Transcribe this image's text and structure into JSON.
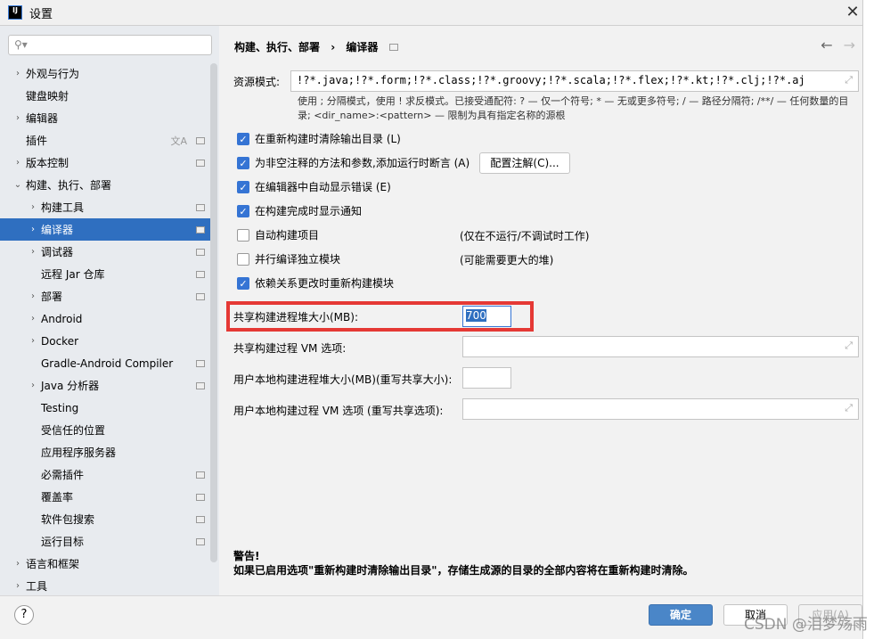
{
  "window": {
    "title": "设置",
    "logo": "IJ",
    "close": "✕"
  },
  "sidebar": {
    "search_placeholder": "",
    "items": [
      {
        "label": "外观与行为",
        "level": 0,
        "chevron": "›"
      },
      {
        "label": "键盘映射",
        "level": 0
      },
      {
        "label": "编辑器",
        "level": 0,
        "chevron": "›"
      },
      {
        "label": "插件",
        "level": 0,
        "translate": true,
        "icon": true
      },
      {
        "label": "版本控制",
        "level": 0,
        "chevron": "›",
        "icon": true
      },
      {
        "label": "构建、执行、部署",
        "level": 0,
        "chevron": "⌄"
      },
      {
        "label": "构建工具",
        "level": 1,
        "chevron": "›",
        "icon": true
      },
      {
        "label": "编译器",
        "level": 1,
        "chevron": "›",
        "icon": true,
        "selected": true
      },
      {
        "label": "调试器",
        "level": 1,
        "chevron": "›",
        "icon": true
      },
      {
        "label": "远程 Jar 仓库",
        "level": 1,
        "icon": true
      },
      {
        "label": "部署",
        "level": 1,
        "chevron": "›",
        "icon": true
      },
      {
        "label": "Android",
        "level": 1,
        "chevron": "›"
      },
      {
        "label": "Docker",
        "level": 1,
        "chevron": "›"
      },
      {
        "label": "Gradle-Android Compiler",
        "level": 1,
        "icon": true
      },
      {
        "label": "Java 分析器",
        "level": 1,
        "chevron": "›",
        "icon": true
      },
      {
        "label": "Testing",
        "level": 1
      },
      {
        "label": "受信任的位置",
        "level": 1
      },
      {
        "label": "应用程序服务器",
        "level": 1
      },
      {
        "label": "必需插件",
        "level": 1,
        "icon": true
      },
      {
        "label": "覆盖率",
        "level": 1,
        "icon": true
      },
      {
        "label": "软件包搜索",
        "level": 1,
        "icon": true
      },
      {
        "label": "运行目标",
        "level": 1,
        "icon": true
      },
      {
        "label": "语言和框架",
        "level": 0,
        "chevron": "›"
      },
      {
        "label": "工具",
        "level": 0,
        "chevron": "›"
      }
    ]
  },
  "breadcrumb": {
    "parent": "构建、执行、部署",
    "sep": "›",
    "current": "编译器"
  },
  "nav": {
    "back": "←",
    "forward": "→"
  },
  "resource": {
    "label": "资源模式:",
    "value": "!?*.java;!?*.form;!?*.class;!?*.groovy;!?*.scala;!?*.flex;!?*.kt;!?*.clj;!?*.aj",
    "hint": "使用 ; 分隔模式，使用 ! 求反模式。已接受通配符: ? — 仅一个符号; * — 无或更多符号; / — 路径分隔符; /**/ — 任何数量的目录; <dir_name>:<pattern> — 限制为具有指定名称的源根"
  },
  "options": [
    {
      "label": "在重新构建时清除输出目录 (L)",
      "checked": true
    },
    {
      "label": "为非空注释的方法和参数,添加运行时断言 (A)",
      "checked": true
    },
    {
      "label": "在编辑器中自动显示错误 (E)",
      "checked": true
    },
    {
      "label": "在构建完成时显示通知",
      "checked": true
    },
    {
      "label": "自动构建项目",
      "checked": false,
      "note": "(仅在不运行/不调试时工作)"
    },
    {
      "label": "并行编译独立模块",
      "checked": false,
      "note": "(可能需要更大的堆)"
    },
    {
      "label": "依赖关系更改时重新构建模块",
      "checked": true
    }
  ],
  "configure_annotations": "配置注解(C)...",
  "heap": {
    "label": "共享构建进程堆大小(MB):",
    "value": "700"
  },
  "vm": {
    "label": "共享构建过程 VM 选项:",
    "value": ""
  },
  "user_heap": {
    "label": "用户本地构建进程堆大小(MB)(重写共享大小):",
    "value": ""
  },
  "user_vm": {
    "label": "用户本地构建过程 VM 选项 (重写共享选项):",
    "value": ""
  },
  "warning": {
    "title": "警告!",
    "text": "如果已启用选项\"重新构建时清除输出目录\"，存储生成源的目录的全部内容将在重新构建时清除。"
  },
  "footer": {
    "help": "?",
    "ok": "确定",
    "cancel": "取消",
    "apply": "应用(A)"
  },
  "watermark": "CSDN @泪梦殇雨",
  "colors": {
    "accent": "#3574d4",
    "selected": "#2f6fc0",
    "highlight": "#e53935"
  }
}
